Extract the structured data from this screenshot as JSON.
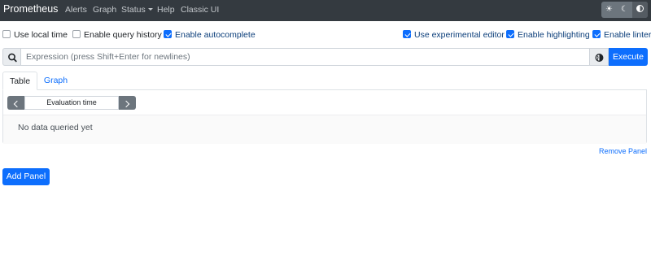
{
  "navbar": {
    "brand": "Prometheus",
    "items": [
      {
        "label": "Alerts"
      },
      {
        "label": "Graph"
      },
      {
        "label": "Status",
        "has_dropdown": true
      },
      {
        "label": "Help"
      },
      {
        "label": "Classic UI"
      }
    ],
    "theme_toggle": {
      "options": [
        {
          "icon": "sun-icon",
          "glyph": "☀"
        },
        {
          "icon": "moon-icon",
          "glyph": "☾"
        },
        {
          "icon": "contrast-icon",
          "glyph": ""
        }
      ],
      "selected": "contrast-icon"
    }
  },
  "options": {
    "left": [
      {
        "label": "Use local time",
        "checked": false
      },
      {
        "label": "Enable query history",
        "checked": false
      },
      {
        "label": "Enable autocomplete",
        "checked": true
      }
    ],
    "right": [
      {
        "label": "Use experimental editor",
        "checked": true
      },
      {
        "label": "Enable highlighting",
        "checked": true
      },
      {
        "label": "Enable linter",
        "checked": true
      }
    ]
  },
  "expression": {
    "placeholder": "Expression (press Shift+Enter for newlines)",
    "value": "",
    "search_icon": "search-icon",
    "metrics_icon": "globe-icon",
    "execute_label": "Execute"
  },
  "panel": {
    "tabs": [
      {
        "label": "Table",
        "active": true
      },
      {
        "label": "Graph",
        "active": false
      }
    ],
    "evaluation_time_placeholder": "Evaluation time",
    "no_data_text": "No data queried yet",
    "remove_label": "Remove Panel"
  },
  "add_panel_label": "Add Panel",
  "colors": {
    "navbar_bg": "#343a40",
    "primary": "#0d6efd",
    "secondary": "#6c757d"
  }
}
